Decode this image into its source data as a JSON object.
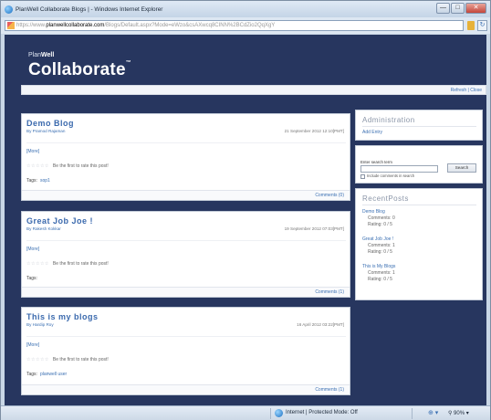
{
  "window": {
    "title": "PlanWell Collaborate Blogs | - Windows Internet Explorer",
    "buttons": {
      "minimize": "—",
      "maximize": "□",
      "close": "✕"
    }
  },
  "address": {
    "prefix": "https://www.",
    "host": "planwellcollaborate.com",
    "rest": "/Blogs/Default.aspx?Mode=eWzo&csAXwcq8CINN%2BCdZio2QqXgY"
  },
  "brand": {
    "small_pre": "Plan",
    "small_bold": "Well",
    "big": "Collaborate",
    "mark": "™"
  },
  "toolbar": {
    "links": "Refresh | Close"
  },
  "posts": [
    {
      "title": "Demo Blog",
      "author": "By Pramod Rajaman",
      "date": "21 September 2012 12:10[PMT]",
      "more": "[More]",
      "rate_text": "Be the first to rate this post!",
      "tags_label": "Tags:",
      "tags": "sop1",
      "comments": "Comments (0)"
    },
    {
      "title": "Great Job Joe !",
      "author": "By Rakesh Kokkar",
      "date": "19 September 2012 07:03[PMT]",
      "more": "[More]",
      "rate_text": "Be the first to rate this post!",
      "tags_label": "Tags:",
      "tags": "",
      "comments": "Comments (1)"
    },
    {
      "title": "This is my blogs",
      "author": "By Hardip Roy",
      "date": "16 April 2012 03:22[PMT]",
      "more": "[More]",
      "rate_text": "Be the first to rate this post!",
      "tags_label": "Tags:",
      "tags": "planwell user",
      "comments": "Comments (1)"
    }
  ],
  "stars": "☆☆☆☆☆",
  "administration": {
    "heading": "Administration",
    "link": "Add Entry"
  },
  "search": {
    "label": "Enter search term",
    "button": "Search",
    "checkbox_label": "Include comments in search"
  },
  "recent": {
    "heading": "RecentPosts",
    "items": [
      {
        "title": "Demo Blog",
        "comments": "Comments: 0",
        "rating": "Rating: 0 / 5"
      },
      {
        "title": "Great Job Joe !",
        "comments": "Comments: 1",
        "rating": "Rating: 0 / 5"
      },
      {
        "title": "This is My Blogs",
        "comments": "Comments: 1",
        "rating": "Rating: 0 / 5"
      }
    ]
  },
  "status": {
    "zone": "Internet | Protected Mode: Off",
    "protected_icon": "⊕ ▾",
    "zoom": "⚲ 90%  ▾"
  }
}
